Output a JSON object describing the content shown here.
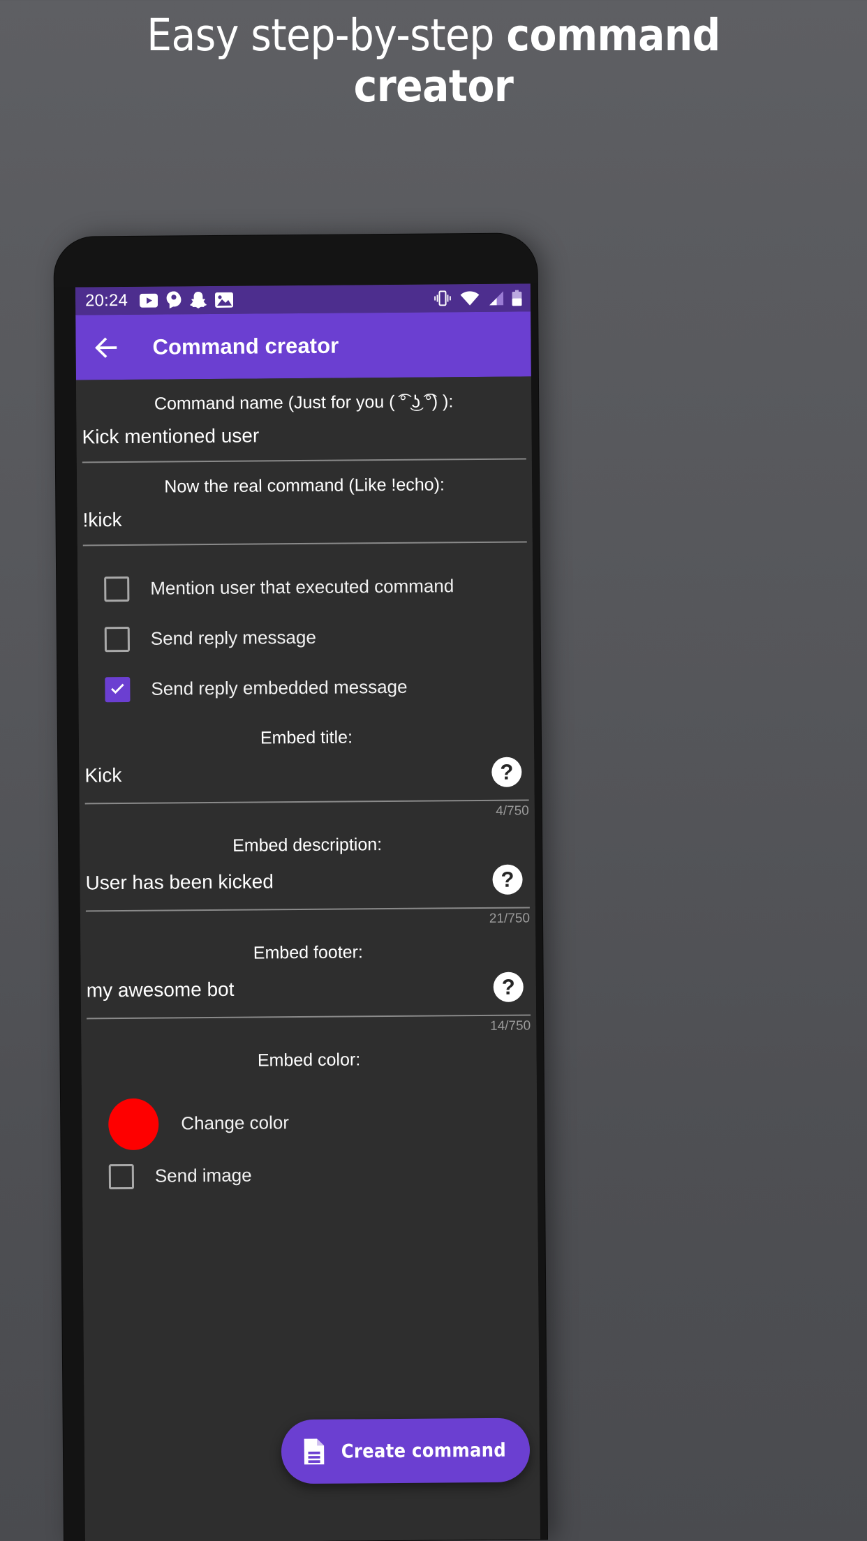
{
  "promo": {
    "headline_light": "Easy step-by-step ",
    "headline_bold": "command creator",
    "background_color": "#55565a"
  },
  "status_bar": {
    "time": "20:24",
    "background_color": "#4d2e8e",
    "notification_icons": [
      "youtube-icon",
      "messenger-icon",
      "snapchat-icon",
      "photos-icon"
    ],
    "system_icons": [
      "vibrate-icon",
      "wifi-icon",
      "signal-icon",
      "battery-icon"
    ]
  },
  "app_bar": {
    "back_label": "back-arrow",
    "title": "Command creator",
    "background_color": "#6b3fd1"
  },
  "form": {
    "command_name": {
      "label": "Command name (Just for you ( ͡° ͜ʖ ͡°) ):",
      "value": "Kick mentioned user"
    },
    "real_command": {
      "label": "Now the real command (Like !echo):",
      "value": "!kick"
    },
    "checkboxes": [
      {
        "label": "Mention user that executed command",
        "checked": false
      },
      {
        "label": "Send reply message",
        "checked": false
      },
      {
        "label": "Send reply embedded message",
        "checked": true
      }
    ],
    "embed_title": {
      "label": "Embed title:",
      "value": "Kick",
      "help": "?",
      "counter": "4/750"
    },
    "embed_description": {
      "label": "Embed description:",
      "value": "User has been kicked",
      "help": "?",
      "counter": "21/750"
    },
    "embed_footer": {
      "label": "Embed footer:",
      "value": "my awesome bot",
      "help": "?",
      "counter": "14/750"
    },
    "embed_color": {
      "label": "Embed color:",
      "swatch_color": "#fe0000",
      "change_label": "Change color"
    },
    "send_image": {
      "label": "Send image",
      "checked": false
    }
  },
  "fab": {
    "label": "Create command",
    "icon": "document-icon",
    "background_color": "#6b3fd1"
  }
}
